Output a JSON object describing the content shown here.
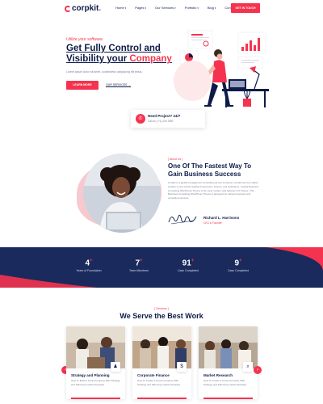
{
  "brand": {
    "name": "corpkit",
    "dot": "."
  },
  "nav": {
    "items": [
      {
        "label": "Home",
        "caret": "▾"
      },
      {
        "label": "Pages",
        "caret": "▾"
      },
      {
        "label": "Our Services",
        "caret": "▾"
      },
      {
        "label": "Portfolio",
        "caret": "▾"
      },
      {
        "label": "Blog",
        "caret": "▾"
      },
      {
        "label": "Contact",
        "caret": ""
      }
    ],
    "cta": "GET IN TOUCH"
  },
  "hero": {
    "tagline": "Utilize your software",
    "title_line1": "Get Fully Control and",
    "title_line2_plain": "Visibility your ",
    "title_line2_accent": "Company",
    "description": "Lorem ipsum dolor sit amet, consectetur adipiscing elit tellus.",
    "primary_button": "LEARN MORE",
    "secondary_link": "OUR SERVICES →",
    "project_box": {
      "title": "Need Project? 24/7",
      "phone": "Call us: (+1) 234 7890"
    }
  },
  "about": {
    "tag": "[ About Us ]",
    "title": "One Of The Fastest Way To Gain Business Success",
    "description": "Corpkit is a global management consulting service company. Corpkit has the market solution to the world's leading businesses, finance, and institutions. Corpkit Business Consulting WordPress Theme is the most modern and features rich Theme. This Business Consulting WordPress Theme is designed for various business and consulting services.",
    "author_name": "Richard L. Harrisons",
    "author_role": "CEO & Founder"
  },
  "stats": [
    {
      "value": "4",
      "suffix": "+",
      "label": "Years of Foundation"
    },
    {
      "value": "7",
      "suffix": "+",
      "label": "Team Members"
    },
    {
      "value": "91",
      "suffix": "+",
      "label": "Case Completed"
    },
    {
      "value": "9",
      "suffix": "+",
      "label": "Case Completed"
    }
  ],
  "services": {
    "tag": "[ Services ]",
    "title": "We Serve the Best Work",
    "cards": [
      {
        "title": "Strategy and Planning",
        "description": "How To Build a Great Company With Strategy and Planning in Early Decades"
      },
      {
        "title": "Corporate Finance",
        "description": "How To Create a Great Company With Strategy and Planning in Early Decades"
      },
      {
        "title": "Market Research",
        "description": "How To Create a Great Company With Strategy and Planning in Early Decades"
      }
    ],
    "prev": "‹",
    "next": "›"
  },
  "colors": {
    "accent": "#f5334f",
    "navy": "#0d1b48",
    "stats_bg": "#1b2a5c"
  }
}
